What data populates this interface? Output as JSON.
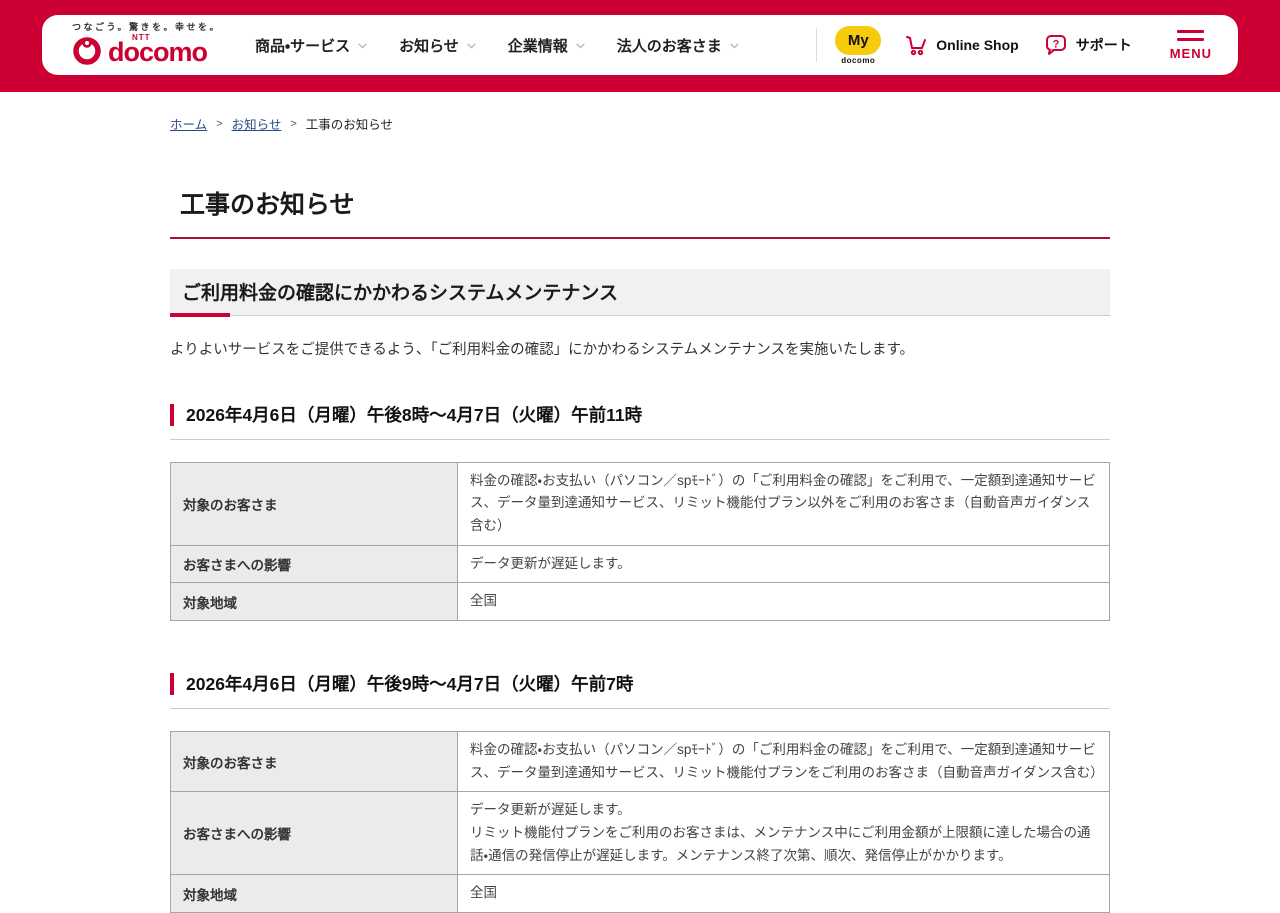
{
  "header": {
    "tagline": "つなごう。驚きを。幸せを。",
    "logo_ntt": "NTT",
    "logo_text": "docomo",
    "nav": [
      {
        "label": "商品・サービス"
      },
      {
        "label": "お知らせ"
      },
      {
        "label": "企業情報"
      },
      {
        "label": "法人のお客さま"
      }
    ],
    "my_docomo": {
      "top": "My",
      "bottom": "docomo"
    },
    "online_shop_label": "Online Shop",
    "support_label": "サポート",
    "support_mark": "?",
    "menu_label": "MENU"
  },
  "breadcrumb": {
    "separator": ">",
    "items": [
      {
        "label": "ホーム"
      },
      {
        "label": "お知らせ"
      },
      {
        "label": "工事のお知らせ"
      }
    ]
  },
  "page": {
    "title": "工事のお知らせ"
  },
  "section": {
    "heading": "ご利用料金の確認にかかわるシステムメンテナンス",
    "intro": "よりよいサービスをご提供できるよう、「ご利用料金の確認」にかかわるシステムメンテナンスを実施いたします。",
    "maintenance": [
      {
        "period": "2026年4月6日（月曜）午後8時～4月7日（火曜）午前11時",
        "rows": [
          {
            "label": "対象のお客さま",
            "value": "料金の確認・お支払い（パソコン／spﾓｰﾄﾞ）の「ご利用料金の確認」をご利用で、一定額到達通知サービス、データ量到達通知サービス、リミット機能付プラン以外をご利用のお客さま（自動音声ガイダンス含む）"
          },
          {
            "label": "お客さまへの影響",
            "value": "データ更新が遅延します。"
          },
          {
            "label": "対象地域",
            "value": "全国"
          }
        ]
      },
      {
        "period": "2026年4月6日（月曜）午後9時～4月7日（火曜）午前7時",
        "rows": [
          {
            "label": "対象のお客さま",
            "value": "料金の確認・お支払い（パソコン／spﾓｰﾄﾞ）の「ご利用料金の確認」をご利用で、一定額到達通知サービス、データ量到達通知サービス、リミット機能付プランをご利用のお客さま（自動音声ガイダンス含む）"
          },
          {
            "label": "お客さまへの影響",
            "value": "データ更新が遅延します。\nリミット機能付プランをご利用のお客さまは、メンテナンス中にご利用金額が上限額に達した場合の通話・通信の発信停止が遅延します。メンテナンス終了次第、順次、発信停止がかかります。"
          },
          {
            "label": "対象地域",
            "value": "全国"
          }
        ]
      }
    ]
  },
  "colors": {
    "brand_crimson": "#cc0033",
    "my_docomo_yellow": "#f6cb0c",
    "heading_gray": "#f1f1f1",
    "table_label_gray": "#ebebeb",
    "table_border": "#a5a5a5",
    "breadcrumb_link": "#2a4a8a"
  }
}
